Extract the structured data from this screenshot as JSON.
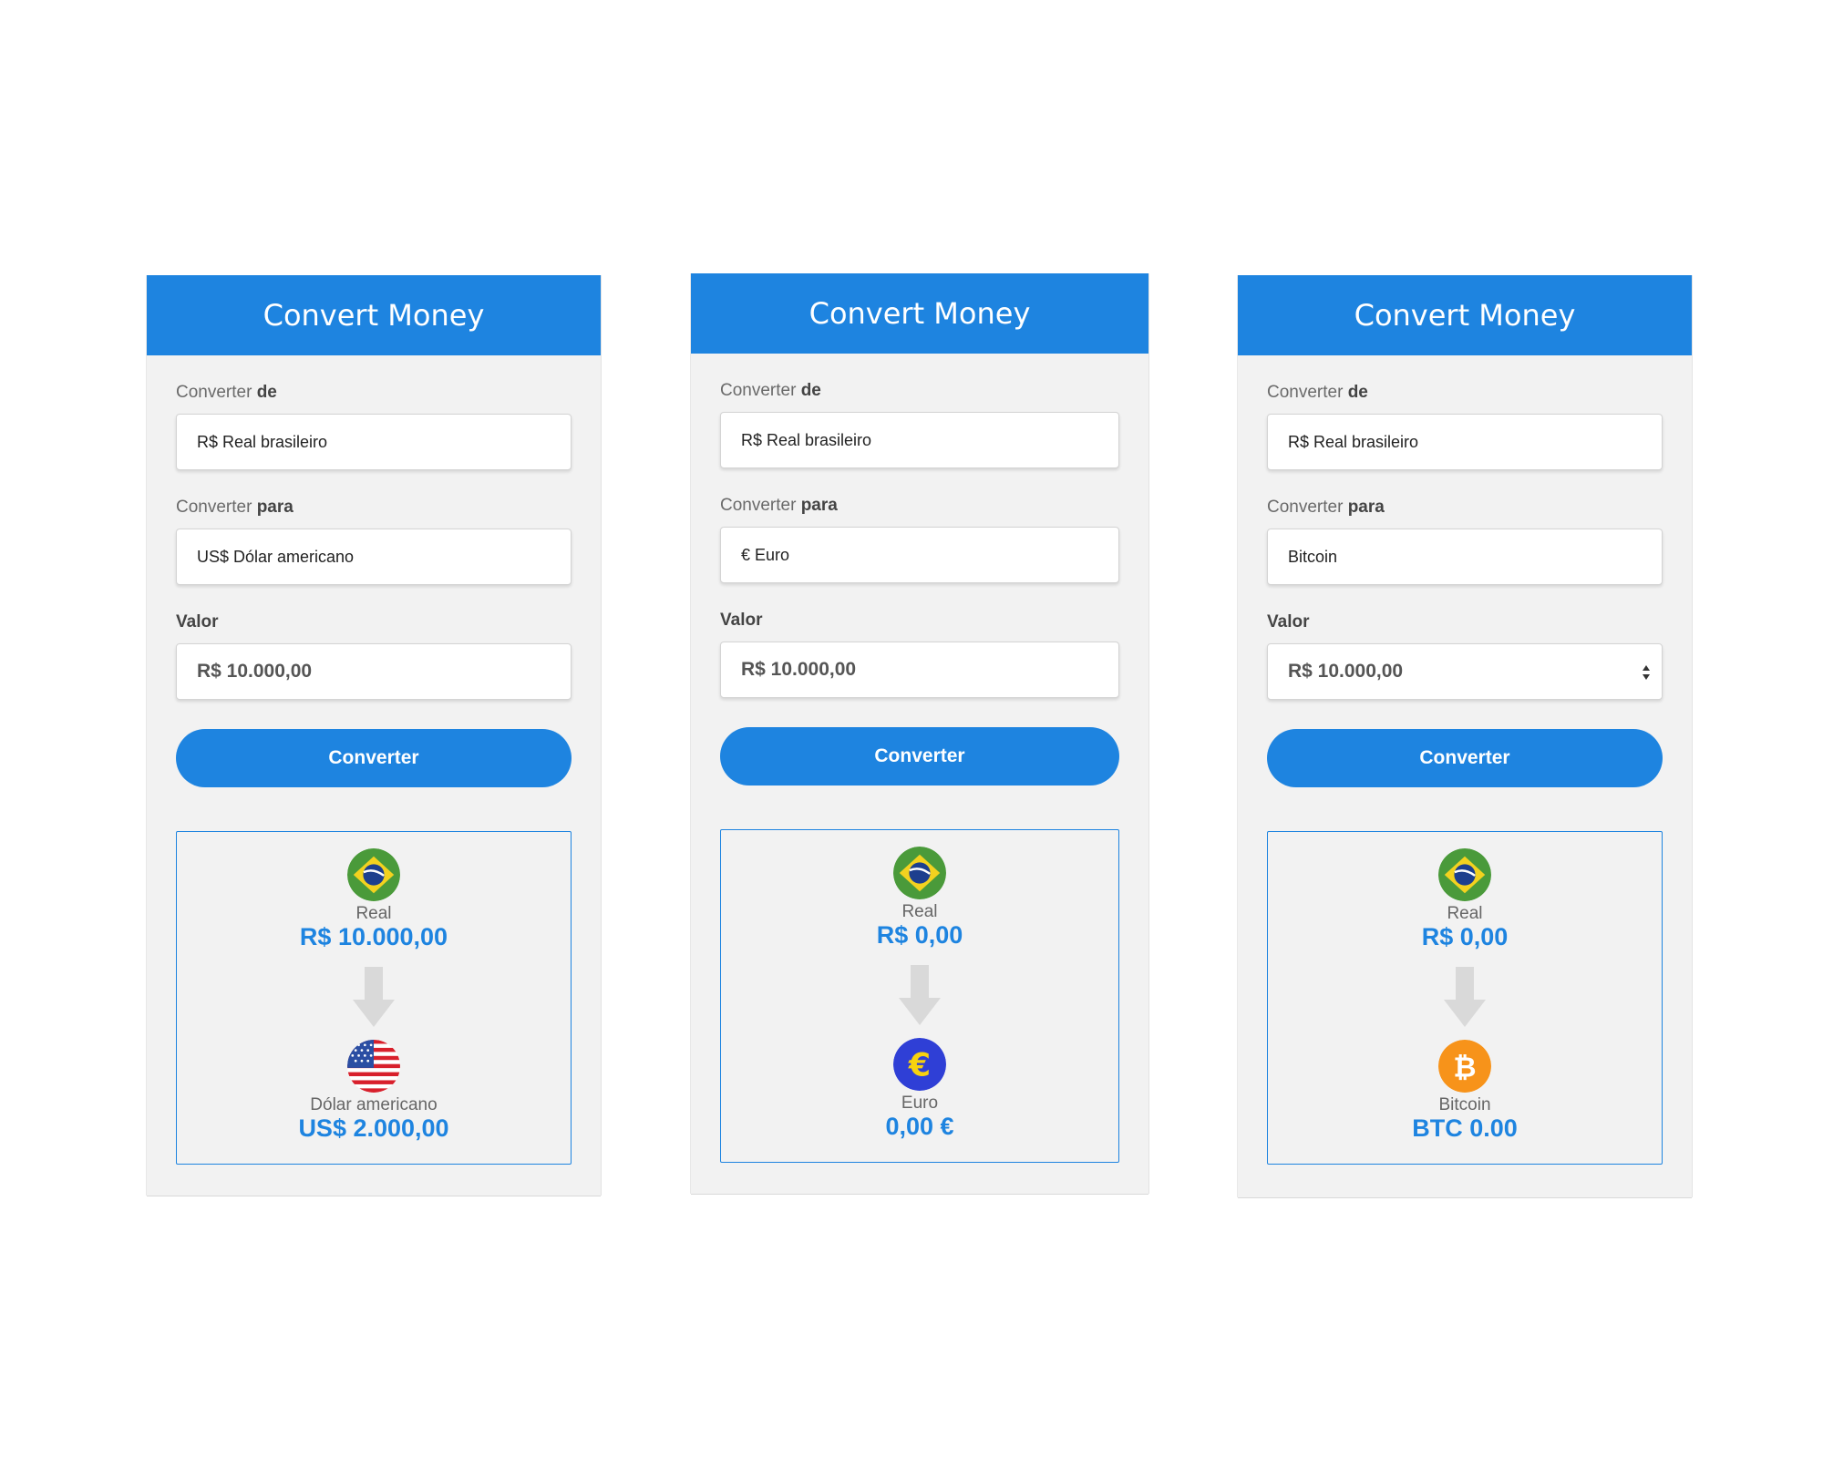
{
  "cards": [
    {
      "title": "Convert Money",
      "from_label_prefix": "Converter",
      "from_label_bold": "de",
      "from_value": "R$ Real brasileiro",
      "to_label_prefix": "Converter",
      "to_label_bold": "para",
      "to_value": "US$ Dólar americano",
      "amount_label": "Valor",
      "amount_value": "R$ 10.000,00",
      "button_label": "Converter",
      "result": {
        "from_name": "Real",
        "from_value": "R$ 10.000,00",
        "from_icon": "brazil-flag-icon",
        "to_name": "Dólar americano",
        "to_value": "US$ 2.000,00",
        "to_icon": "usa-flag-icon"
      }
    },
    {
      "title": "Convert Money",
      "from_label_prefix": "Converter",
      "from_label_bold": "de",
      "from_value": "R$ Real brasileiro",
      "to_label_prefix": "Converter",
      "to_label_bold": "para",
      "to_value": "€ Euro",
      "amount_label": "Valor",
      "amount_value": "R$ 10.000,00",
      "button_label": "Converter",
      "result": {
        "from_name": "Real",
        "from_value": "R$ 0,00",
        "from_icon": "brazil-flag-icon",
        "to_name": "Euro",
        "to_value": "0,00 €",
        "to_icon": "euro-icon"
      }
    },
    {
      "title": "Convert Money",
      "from_label_prefix": "Converter",
      "from_label_bold": "de",
      "from_value": "R$ Real brasileiro",
      "to_label_prefix": "Converter",
      "to_label_bold": "para",
      "to_value": "Bitcoin",
      "amount_label": "Valor",
      "amount_value": "R$ 10.000,00",
      "button_label": "Converter",
      "result": {
        "from_name": "Real",
        "from_value": "R$ 0,00",
        "from_icon": "brazil-flag-icon",
        "to_name": "Bitcoin",
        "to_value": "BTC 0.00",
        "to_icon": "bitcoin-icon"
      }
    }
  ],
  "colors": {
    "primary": "#1e84e0",
    "card_bg": "#f2f2f2",
    "brazil_green": "#4a9a3a",
    "brazil_yellow": "#f3d21f",
    "brazil_blue": "#1d3f8e",
    "usa_red": "#d8202c",
    "usa_blue": "#2b4ea3",
    "euro_blue": "#2f3fd6",
    "euro_yellow": "#f8d20e",
    "bitcoin_orange": "#f7931a"
  }
}
